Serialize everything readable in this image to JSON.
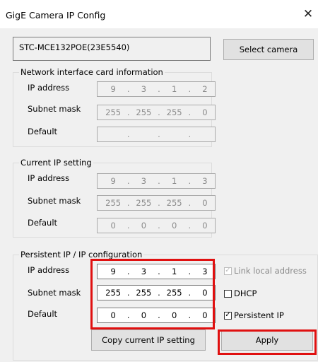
{
  "window": {
    "title": "GigE Camera IP Config",
    "close_glyph": "✕"
  },
  "camera": {
    "name": "STC-MCE132POE(23E5540)",
    "select_button": "Select camera"
  },
  "nic": {
    "title": "Network interface card information",
    "ip_label": "IP address",
    "ip": [
      "9",
      "3",
      "1",
      "2"
    ],
    "mask_label": "Subnet mask",
    "mask": [
      "255",
      "255",
      "255",
      "0"
    ],
    "default_label": "Default",
    "default": [
      "",
      "",
      "",
      ""
    ]
  },
  "current": {
    "title": "Current IP setting",
    "ip_label": "IP address",
    "ip": [
      "9",
      "3",
      "1",
      "3"
    ],
    "mask_label": "Subnet mask",
    "mask": [
      "255",
      "255",
      "255",
      "0"
    ],
    "default_label": "Default",
    "default": [
      "0",
      "0",
      "0",
      "0"
    ]
  },
  "persistent": {
    "title": "Persistent IP / IP configuration",
    "ip_label": "IP address",
    "ip": [
      "9",
      "3",
      "1",
      "3"
    ],
    "mask_label": "Subnet mask",
    "mask": [
      "255",
      "255",
      "255",
      "0"
    ],
    "default_label": "Default",
    "default": [
      "0",
      "0",
      "0",
      "0"
    ],
    "link_local": {
      "label": "Link local address",
      "checked": true,
      "enabled": false
    },
    "dhcp": {
      "label": "DHCP",
      "checked": false
    },
    "persistent_ip": {
      "label": "Persistent IP",
      "checked": true
    },
    "copy_button": "Copy current IP setting",
    "apply_button": "Apply"
  },
  "dot": ".",
  "check_glyph": "✓",
  "colors": {
    "highlight": "#e01010",
    "background": "#f0f0f0",
    "disabled_text": "#8a8a8a"
  }
}
